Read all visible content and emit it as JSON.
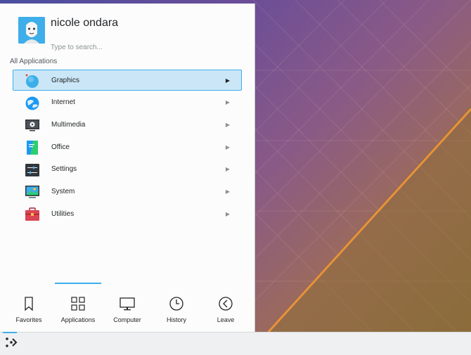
{
  "user": {
    "name": "nicole ondara"
  },
  "search": {
    "placeholder": "Type to search..."
  },
  "section": {
    "title": "All Applications"
  },
  "categories": [
    {
      "label": "Graphics",
      "icon": "graphics-icon",
      "selected": true
    },
    {
      "label": "Internet",
      "icon": "internet-icon"
    },
    {
      "label": "Multimedia",
      "icon": "multimedia-icon"
    },
    {
      "label": "Office",
      "icon": "office-icon"
    },
    {
      "label": "Settings",
      "icon": "settings-icon"
    },
    {
      "label": "System",
      "icon": "system-icon"
    },
    {
      "label": "Utilities",
      "icon": "utilities-icon"
    }
  ],
  "tabs": [
    {
      "label": "Favorites",
      "icon": "bookmark-icon"
    },
    {
      "label": "Applications",
      "icon": "grid-icon",
      "active": true
    },
    {
      "label": "Computer",
      "icon": "monitor-icon"
    },
    {
      "label": "History",
      "icon": "clock-icon"
    },
    {
      "label": "Leave",
      "icon": "back-arrow-icon"
    }
  ],
  "colors": {
    "accent": "#3daee9",
    "selection": "#cbe7f7"
  }
}
